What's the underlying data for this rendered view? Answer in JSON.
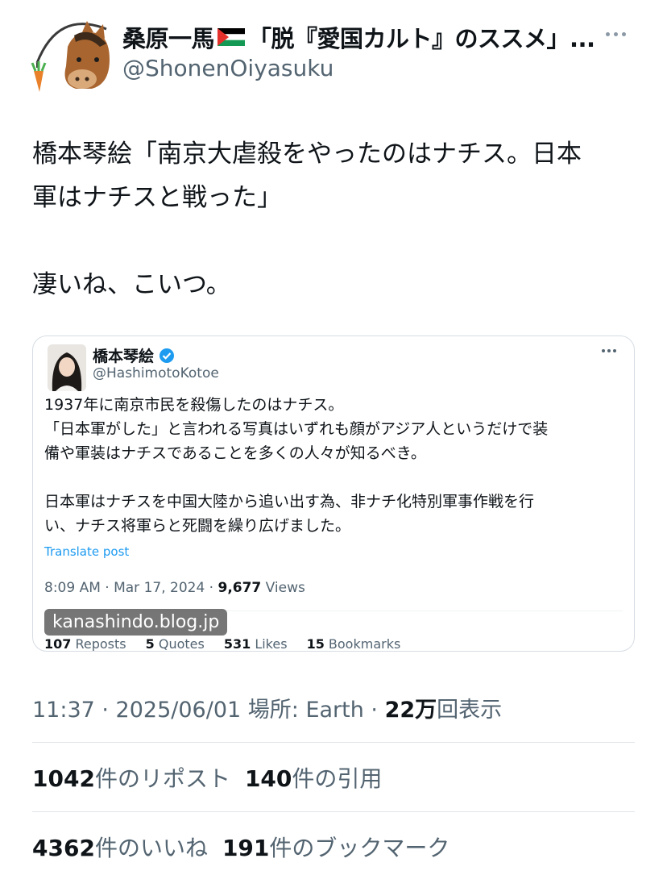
{
  "author": {
    "display_name": "桑原一馬",
    "display_name_suffix": "「脱『愛国カルト』のススメ」...",
    "handle": "@ShonenOiyasuku",
    "flag_icon": "palestine-flag"
  },
  "tweet": {
    "lines": [
      "橋本琴絵「南京大虐殺をやったのはナチス。日本",
      "軍はナチスと戦った」",
      "",
      "凄いね、こいつ。"
    ]
  },
  "quote": {
    "name": "橋本琴絵",
    "handle": "@HashimotoKotoe",
    "body_lines": [
      "1937年に南京市民を殺傷したのはナチス。",
      "「日本軍がした」と言われる写真はいずれも顔がアジア人というだけで装",
      "備や軍装はナチスであることを多くの人々が知るべき。",
      "",
      "日本軍はナチスを中国大陸から追い出す為、非ナチ化特別軍事作戦を行",
      "い、ナチス将軍らと死闘を繰り広げました。"
    ],
    "translate_label": "Translate post",
    "time": "8:09 AM · Mar 17, 2024 · ",
    "views_count": "9,677",
    "views_label": " Views",
    "reposts_count": "107",
    "reposts_label": " Reposts",
    "quotes_count": "5",
    "quotes_label": " Quotes",
    "likes_count": "531",
    "likes_label": " Likes",
    "bookmarks_count": "15",
    "bookmarks_label": " Bookmarks",
    "watermark": "kanashindo.blog.jp"
  },
  "meta": {
    "timestamp": "11:37 · 2025/06/01 場所: Earth · ",
    "views_count": "22万",
    "views_label": "回表示"
  },
  "stats": {
    "reposts_count": "1042",
    "reposts_label": "件のリポスト",
    "quotes_count": "140",
    "quotes_label": "件の引用",
    "likes_count": "4362",
    "likes_label": "件のいいね",
    "bookmarks_count": "191",
    "bookmarks_label": "件のブックマーク"
  },
  "colors": {
    "text": "#0f1419",
    "secondary": "#536471",
    "link": "#1d9bf0",
    "border": "#d6dde3"
  }
}
